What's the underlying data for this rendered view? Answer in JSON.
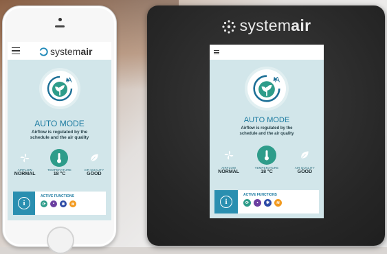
{
  "brand": {
    "name_light": "system",
    "name_bold": "air"
  },
  "app": {
    "logo_light": "system",
    "logo_bold": "air",
    "mode_letter": "A",
    "mode_title": "AUTO MODE",
    "mode_desc_line1": "Airflow is regulated by the",
    "mode_desc_line2": "schedule and the air quality",
    "metrics": [
      {
        "icon": "fan-icon",
        "label": "AIRFLOW",
        "value": "NORMAL"
      },
      {
        "icon": "thermometer-icon",
        "label": "TEMPERATURE",
        "value": "18 °C"
      },
      {
        "icon": "leaf-icon",
        "label": "AIR QUALITY",
        "value": "GOOD"
      }
    ],
    "active_label": "ACTIVE FUNCTIONS",
    "functions": [
      {
        "icon": "eco-icon",
        "color": "#2e9c8a"
      },
      {
        "icon": "drop-icon",
        "color": "#6b3fa0"
      },
      {
        "icon": "snowflake-icon",
        "color": "#2b4aa6"
      },
      {
        "icon": "heat-icon",
        "color": "#f29a1f"
      }
    ]
  },
  "colors": {
    "screen_bg": "#d2e6ea",
    "accent_blue": "#1b7aa0",
    "accent_teal": "#2e9c8a"
  }
}
